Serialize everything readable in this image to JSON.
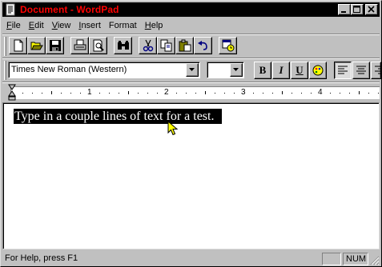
{
  "window": {
    "title": "Document - WordPad",
    "title_color": "#ff0000",
    "titlebar_bg": "#000000",
    "controls": [
      "minimize-icon",
      "maximize-icon",
      "close-icon"
    ]
  },
  "menu": {
    "items": [
      {
        "label": "File",
        "accel": "F",
        "rest": "ile"
      },
      {
        "label": "Edit",
        "accel": "E",
        "rest": "dit"
      },
      {
        "label": "View",
        "accel": "V",
        "rest": "iew"
      },
      {
        "label": "Insert",
        "accel": "I",
        "rest": "nsert"
      },
      {
        "label": "Format",
        "accel": "",
        "rest": "Format"
      },
      {
        "label": "Help",
        "accel": "H",
        "rest": "elp"
      }
    ]
  },
  "toolbar": {
    "buttons": [
      "new-icon",
      "open-icon",
      "save-icon",
      "print-icon",
      "print-preview-icon",
      "find-icon",
      "cut-icon",
      "copy-icon",
      "paste-icon",
      "undo-icon",
      "date-time-icon"
    ]
  },
  "formatbar": {
    "font_name": "Times New Roman (Western)",
    "font_size": "",
    "bold": "B",
    "italic": "I",
    "underline": "U",
    "buttons": [
      "bold-icon",
      "italic-icon",
      "underline-icon",
      "color-icon",
      "align-left-icon",
      "align-center-icon",
      "align-right-icon"
    ],
    "align_left_pressed": true
  },
  "ruler": {
    "labels": [
      "1",
      "2",
      "3",
      "4"
    ]
  },
  "document": {
    "text": "Type in a couple lines of text for a test.",
    "selection_bg": "#000000",
    "selection_fg": "#ffffff"
  },
  "statusbar": {
    "message": "For Help, press F1",
    "num_indicator": "NUM"
  }
}
